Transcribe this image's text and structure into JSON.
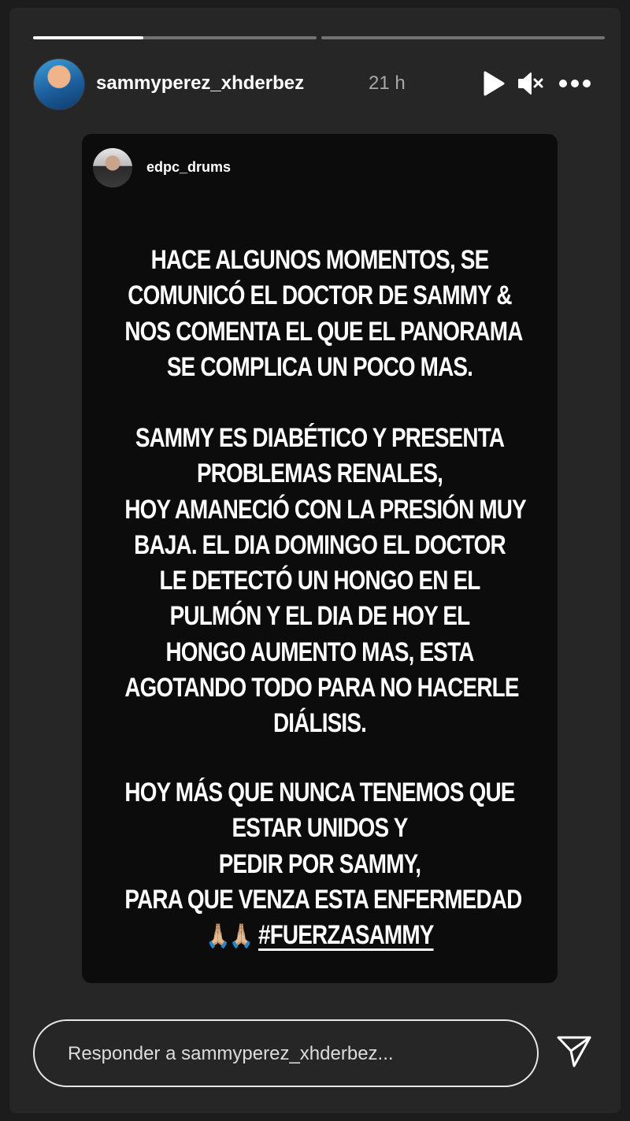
{
  "story": {
    "username": "sammyperez_xhderbez",
    "time": "21 h",
    "progress": [
      0.39,
      0.0
    ]
  },
  "shared_post": {
    "username": "edpc_drums",
    "paragraph1": [
      "HACE ALGUNOS MOMENTOS, SE",
      "COMUNICÓ EL DOCTOR DE SAMMY  &",
      "NOS COMENTA EL QUE EL PANORAMA",
      "SE COMPLICA UN POCO MAS."
    ],
    "paragraph2": [
      "SAMMY ES DIABÉTICO Y PRESENTA",
      "PROBLEMAS RENALES,",
      "HOY AMANECIÓ CON LA PRESIÓN MUY",
      "BAJA. EL DIA DOMINGO EL DOCTOR",
      "LE DETECTÓ UN HONGO EN EL",
      "PULMÓN Y EL DIA DE HOY EL",
      "HONGO AUMENTO MAS, ESTA",
      "AGOTANDO TODO PARA NO HACERLE",
      "DIÁLISIS."
    ],
    "paragraph3": [
      "HOY MÁS QUE NUNCA TENEMOS QUE",
      "ESTAR UNIDOS Y",
      "PEDIR POR SAMMY,",
      "PARA QUE VENZA ESTA ENFERMEDAD"
    ],
    "emoji": "🙏🏼🙏🏼",
    "hashtag": "#FUERZASAMMY"
  },
  "reply": {
    "placeholder": "Responder a sammyperez_xhderbez..."
  },
  "icons": {
    "play": "play-icon",
    "mute": "mute-icon",
    "more": "more-icon",
    "send": "send-icon"
  },
  "colors": {
    "background": "#1c1c1c",
    "frame": "#262626",
    "card": "#0c0c0c",
    "text": "#ffffff",
    "muted": "#a8a8a8"
  }
}
